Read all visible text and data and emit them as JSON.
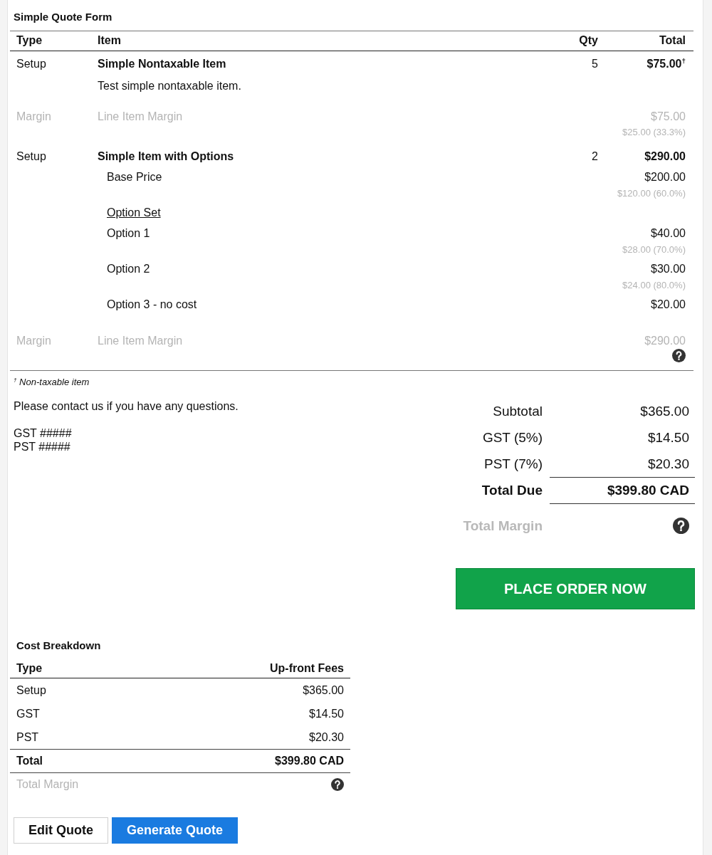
{
  "form": {
    "title": "Simple Quote Form",
    "columns": [
      "Type",
      "Item",
      "Qty",
      "Total"
    ]
  },
  "line_items": [
    {
      "kind": "item",
      "type": "Setup",
      "name": "Simple Nontaxable Item",
      "qty": "5",
      "total": "$75.00$^{†}$",
      "description": "Test simple nontaxable item."
    },
    {
      "kind": "margin",
      "type": "Margin",
      "name": "Line Item Margin",
      "total": "$75.00",
      "detail": "$25.00 (33.3%)"
    },
    {
      "kind": "item",
      "type": "Setup",
      "name": "Simple Item with Options",
      "qty": "2",
      "total": "$290.00",
      "components": [
        {
          "kind": "price",
          "label": "Base Price",
          "amount": "$200.00",
          "cost": "$120.00 (60.0%)"
        },
        {
          "kind": "heading",
          "label": "Option Set"
        },
        {
          "kind": "price",
          "label": "Option 1",
          "amount": "$40.00",
          "cost": "$28.00 (70.0%)"
        },
        {
          "kind": "price",
          "label": "Option 2",
          "amount": "$30.00",
          "cost": "$24.00 (80.0%)"
        },
        {
          "kind": "price",
          "label": "Option 3 - no cost",
          "amount": "$20.00"
        }
      ]
    },
    {
      "kind": "margin",
      "type": "Margin",
      "name": "Line Item Margin",
      "total": "$290.00",
      "help": true
    }
  ],
  "footnote": "$^{†}$ Non-taxable item",
  "notes": {
    "message": "Please contact us if you have any questions.",
    "tax_numbers": [
      "GST #####",
      "PST #####"
    ]
  },
  "summary": [
    {
      "kind": "plain",
      "label": "Subtotal",
      "value": "$365.00"
    },
    {
      "kind": "plain",
      "label": "GST (5%)",
      "value": "$14.50"
    },
    {
      "kind": "plain",
      "label": "PST (7%)",
      "value": "$20.30"
    },
    {
      "kind": "total",
      "label": "Total Due",
      "value": "$399.80 CAD"
    },
    {
      "kind": "margin",
      "label": "Total Margin",
      "help": true
    }
  ],
  "place_order_button": "PLACE ORDER NOW",
  "cost_breakdown": {
    "title": "Cost Breakdown",
    "columns": [
      "Type",
      "Up-front Fees"
    ],
    "rows": [
      {
        "kind": "plain",
        "type": "Setup",
        "amount": "$365.00"
      },
      {
        "kind": "plain",
        "type": "GST",
        "amount": "$14.50"
      },
      {
        "kind": "plain",
        "type": "PST",
        "amount": "$20.30"
      },
      {
        "kind": "total",
        "type": "Total",
        "amount": "$399.80 CAD"
      },
      {
        "kind": "margin",
        "type": "Total Margin",
        "help": true
      }
    ]
  },
  "buttons": [
    {
      "kind": "secondary",
      "label": "Edit Quote"
    },
    {
      "kind": "primary",
      "label": "Generate Quote"
    }
  ]
}
